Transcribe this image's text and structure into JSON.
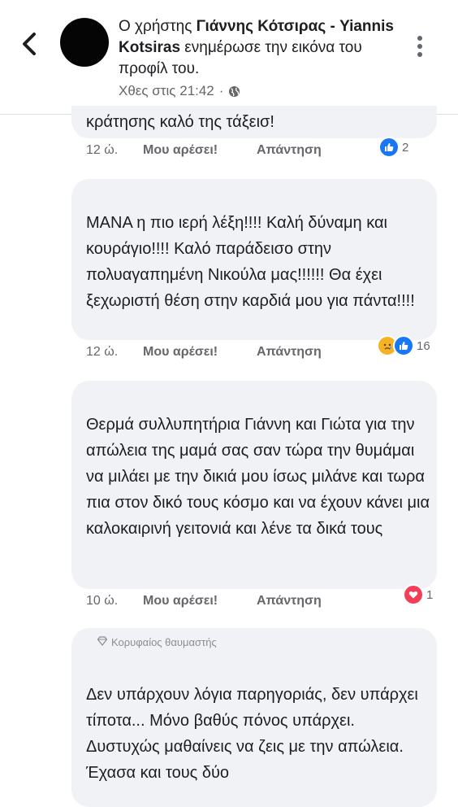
{
  "header": {
    "prefix": "Ο χρήστης ",
    "name": "Γιάννης Κότσιρας - Yiannis Kotsiras",
    "suffix": " ενημέρωσε την εικόνα του προφίλ του.",
    "timestamp": "Χθες στις 21:42",
    "separator": "·",
    "icons": {
      "back": "chevron-left-icon",
      "audience": "globe-icon",
      "more": "more-vertical-icon"
    }
  },
  "actions": {
    "like": "Μου αρέσει!",
    "reply": "Απάντηση"
  },
  "comments": [
    {
      "text_partial": "κράτησης καλό της τάξεισ!",
      "time": "12 ώ.",
      "reactions": {
        "icons": [
          "like"
        ],
        "count": "2"
      }
    },
    {
      "text": "ΜΑΝΑ η πιο ιερή λέξη!!!! Καλή δύναμη και κουράγιο!!!! Καλό παράδεισο στην πολυαγαπημένη Νικούλα μας!!!!!! Θα έχει ξεχωριστή θέση στην καρδιά μου για πάντα!!!!",
      "time": "12 ώ.",
      "reactions": {
        "icons": [
          "sad",
          "like"
        ],
        "count": "16"
      }
    },
    {
      "text": "Θερμά συλλυπητήρια Γιάννη και Γιώτα για την απώλεια της μαμά σας σαν τώρα την θυμάμαι να μιλάει με την δικιά μου ίσως μιλάνε και τωρα πια στον δικό τους κόσμο και να έχουν κάνει μια καλοκαιρινή γειτονιά και λένε τα δικά τους",
      "time": "10 ώ.",
      "reactions": {
        "icons": [
          "love"
        ],
        "count": "1"
      }
    },
    {
      "badge": "Κορυφαίος θαυμαστής",
      "text": "Δεν υπάρχουν λόγια παρηγοριάς, δεν υπάρχει τίποτα... Μόνο βαθύς πόνος υπάρχει. Δυστυχώς μαθαίνεις να ζεις με την απώλεια. Έχασα και τους δύο"
    }
  ],
  "colors": {
    "bubble": "#f0f2f5",
    "like": "#1877f2",
    "love": "#f33e58",
    "sad": "#f7b125",
    "meta": "#65676b"
  }
}
